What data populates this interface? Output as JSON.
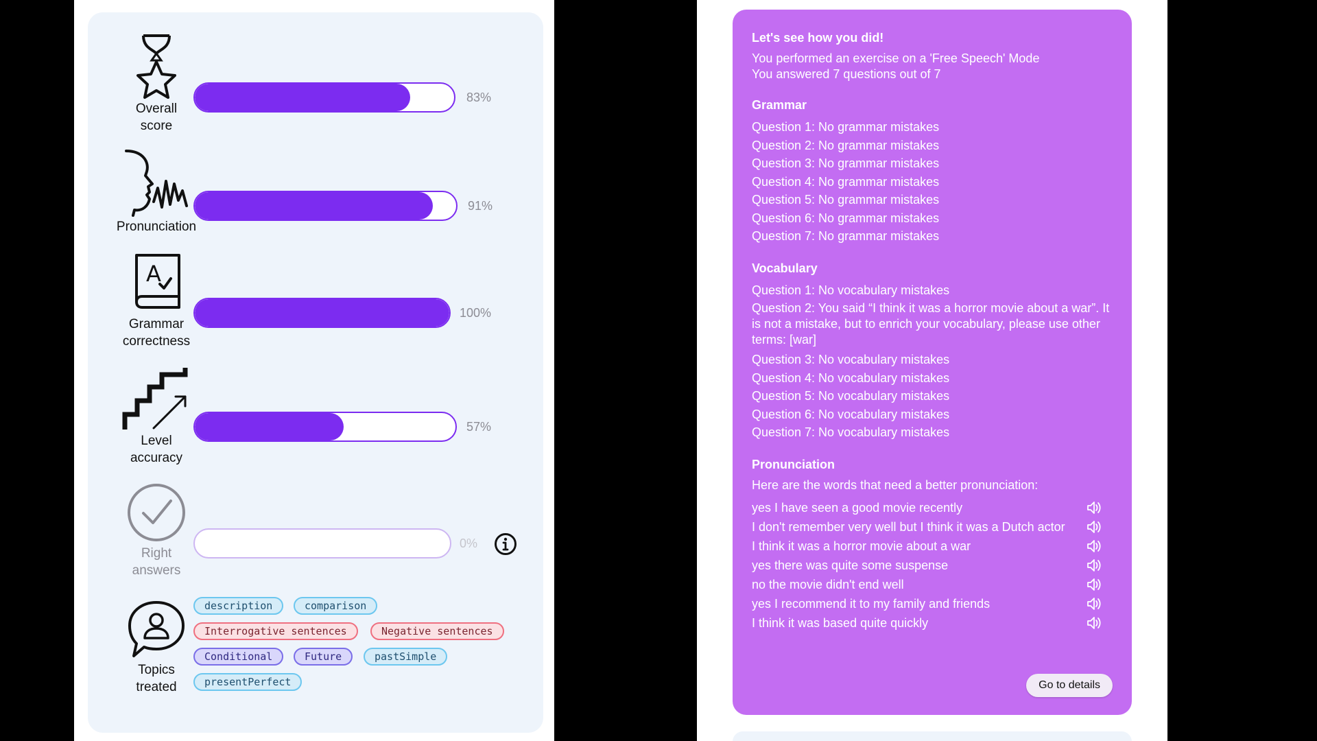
{
  "left": {
    "metrics": [
      {
        "label_1": "Overall",
        "label_2": "score",
        "percent_text": "83%",
        "fill": 0.83,
        "icon": "trophy-star-icon"
      },
      {
        "label_1": "Pronunciation",
        "label_2": "",
        "percent_text": "91%",
        "fill": 0.91,
        "icon": "speaking-head-icon"
      },
      {
        "label_1": "Grammar",
        "label_2": "correctness",
        "percent_text": "100%",
        "fill": 1.0,
        "icon": "grammar-book-icon"
      },
      {
        "label_1": "Level",
        "label_2": "accuracy",
        "percent_text": "57%",
        "fill": 0.57,
        "icon": "stairs-arrow-icon"
      },
      {
        "label_1": "Right",
        "label_2": "answers",
        "percent_text": "0%",
        "fill": 0.0,
        "icon": "check-circle-icon"
      },
      {
        "label_1": "Topics",
        "label_2": "treated",
        "icon": "chat-user-icon"
      }
    ],
    "tags": [
      {
        "text": "description",
        "color": "blue"
      },
      {
        "text": "comparison",
        "color": "blue"
      },
      {
        "text": "Interrogative sentences",
        "color": "red"
      },
      {
        "text": "Negative sentences",
        "color": "red"
      },
      {
        "text": "Conditional",
        "color": "violet"
      },
      {
        "text": "Future",
        "color": "violet"
      },
      {
        "text": "pastSimple",
        "color": "blue"
      },
      {
        "text": "presentPerfect",
        "color": "blue"
      }
    ],
    "colors": {
      "bar": "#7c2cf0",
      "card": "#eef4fb"
    }
  },
  "feedback": {
    "title": "Let's see how you did!",
    "mode_line": "You performed an exercise on a 'Free Speech' Mode",
    "answered_line": "You answered 7 questions out of 7",
    "grammar_heading": "Grammar",
    "grammar": [
      "Question 1: No grammar mistakes",
      "Question 2: No grammar mistakes",
      "Question 3: No grammar mistakes",
      "Question 4: No grammar mistakes",
      "Question 5: No grammar mistakes",
      "Question 6: No grammar mistakes",
      "Question 7: No grammar mistakes"
    ],
    "vocabulary_heading": "Vocabulary",
    "vocabulary": [
      "Question 1: No vocabulary mistakes",
      "Question 2: You said “I think it was a horror movie about a war”. It is not a mistake, but to enrich your vocabulary, please use other terms: [war]",
      "Question 3: No vocabulary mistakes",
      "Question 4: No vocabulary mistakes",
      "Question 5: No vocabulary mistakes",
      "Question 6: No vocabulary mistakes",
      "Question 7: No vocabulary mistakes"
    ],
    "pronunciation_heading": "Pronunciation",
    "pronunciation_intro": "Here are the words that need a better pronunciation:",
    "pronunciation": [
      "yes I have seen a good movie recently",
      "I don't remember very well but I think it was a Dutch actor",
      "I think it was a horror movie about a war",
      "yes there was quite some suspense",
      "no the movie didn't end well",
      "yes I recommend it to my family and friends",
      "I think it was based quite quickly"
    ],
    "details_button": "Go to details",
    "colors": {
      "panel": "#c36df2"
    }
  }
}
